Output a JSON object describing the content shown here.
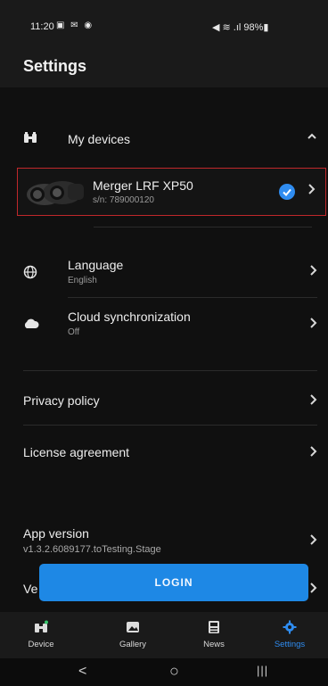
{
  "status_bar": {
    "time": "11:20",
    "left_icons": "▣ ✉ ◉",
    "right_text": "◀︎ ≋ .ıl 98%▮"
  },
  "app_bar": {
    "title": "Settings"
  },
  "devices_section": {
    "title": "My devices",
    "device": {
      "name": "Merger LRF XP50",
      "serial": "s/n: 789000120"
    }
  },
  "rows": {
    "language": {
      "title": "Language",
      "value": "English"
    },
    "cloud": {
      "title": "Cloud synchronization",
      "value": "Off"
    },
    "privacy": {
      "title": "Privacy policy"
    },
    "license": {
      "title": "License agreement"
    },
    "app_version": {
      "title": "App version",
      "value": "v1.3.2.6089177.toTesting.Stage"
    },
    "partial": {
      "title": "Ve"
    }
  },
  "login_label": "LOGIN",
  "bottom_nav": [
    {
      "label": "Device"
    },
    {
      "label": "Gallery"
    },
    {
      "label": "News"
    },
    {
      "label": "Settings"
    }
  ],
  "system_nav": {
    "back": "<",
    "home": "○",
    "recents": "|||"
  },
  "colors": {
    "accent": "#1e88e5",
    "highlight_border": "#c0282b",
    "background": "#101010"
  }
}
